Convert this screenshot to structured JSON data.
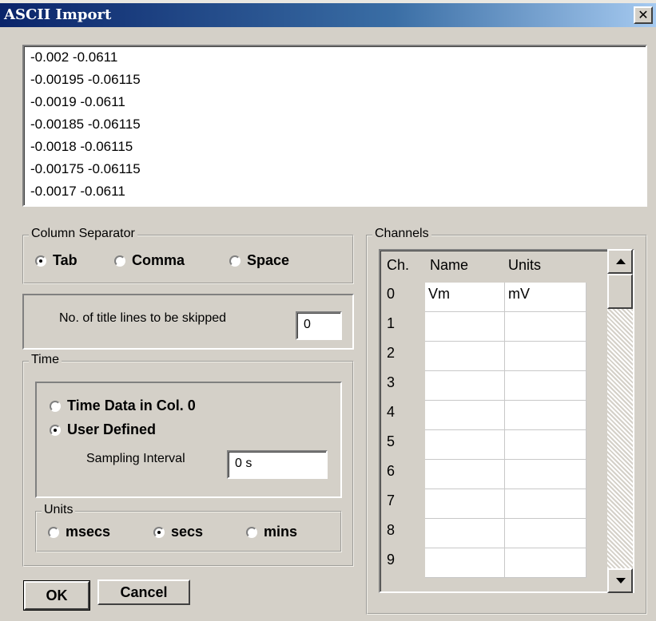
{
  "window": {
    "title": "ASCII Import",
    "close_glyph": "✕"
  },
  "preview_lines": [
    "-0.002     -0.0611",
    "-0.00195 -0.06115",
    "-0.0019   -0.0611",
    "-0.00185 -0.06115",
    "-0.0018   -0.06115",
    "-0.00175 -0.06115",
    "-0.0017   -0.0611"
  ],
  "column_separator": {
    "legend": "Column Separator",
    "options": [
      "Tab",
      "Comma",
      "Space"
    ],
    "selected": "Tab"
  },
  "title_lines": {
    "label": "No. of title lines to be skipped",
    "value": "0"
  },
  "time": {
    "legend": "Time",
    "options": [
      "Time Data in Col. 0",
      "User Defined"
    ],
    "selected": "User Defined",
    "sampling_label": "Sampling Interval",
    "sampling_value": "0 s",
    "units": {
      "legend": "Units",
      "options": [
        "msecs",
        "secs",
        "mins"
      ],
      "selected": "secs"
    }
  },
  "buttons": {
    "ok": "OK",
    "cancel": "Cancel"
  },
  "channels": {
    "legend": "Channels",
    "headers": [
      "Ch.",
      "Name",
      "Units"
    ],
    "rows": [
      {
        "ch": "0",
        "name": "Vm",
        "units": "mV"
      },
      {
        "ch": "1",
        "name": "",
        "units": ""
      },
      {
        "ch": "2",
        "name": "",
        "units": ""
      },
      {
        "ch": "3",
        "name": "",
        "units": ""
      },
      {
        "ch": "4",
        "name": "",
        "units": ""
      },
      {
        "ch": "5",
        "name": "",
        "units": ""
      },
      {
        "ch": "6",
        "name": "",
        "units": ""
      },
      {
        "ch": "7",
        "name": "",
        "units": ""
      },
      {
        "ch": "8",
        "name": "",
        "units": ""
      },
      {
        "ch": "9",
        "name": "",
        "units": ""
      }
    ]
  },
  "colors": {
    "face": "#d4d0c8",
    "title_start": "#0a246a",
    "title_end": "#a6caf0"
  },
  "icons": {
    "close": "close-icon",
    "scroll_up": "arrow-up-icon",
    "scroll_down": "arrow-down-icon"
  }
}
